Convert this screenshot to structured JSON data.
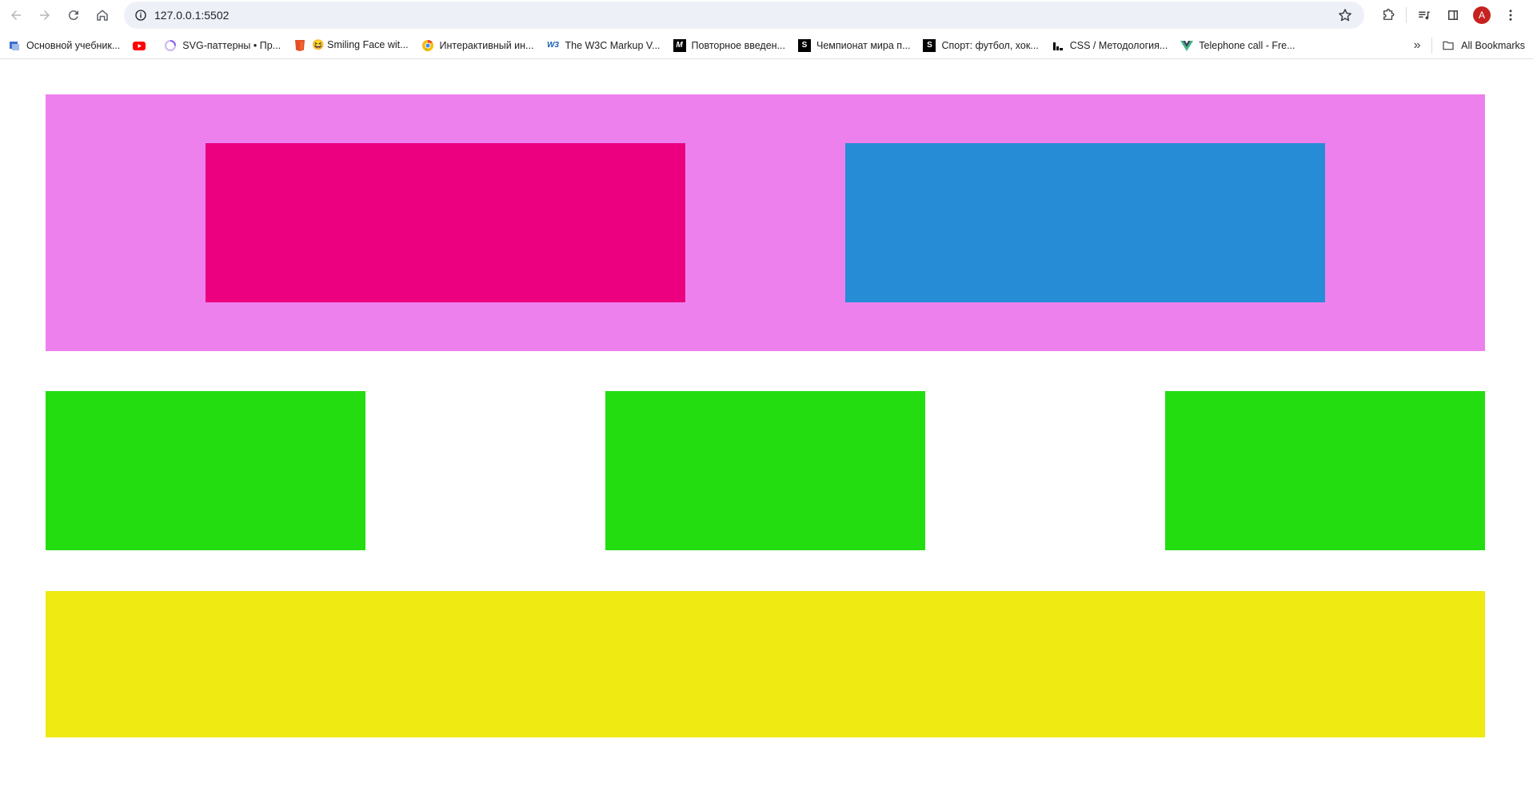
{
  "browser": {
    "url": "127.0.0.1:5502",
    "avatar_letter": "A",
    "all_bookmarks_label": "All Bookmarks",
    "bookmarks": [
      {
        "label": "Основной учебник...",
        "icon": "book-icon"
      },
      {
        "label": "",
        "icon": "youtube-icon"
      },
      {
        "label": "SVG-паттерны • Пр...",
        "icon": "loader-icon"
      },
      {
        "label": "😆 Smiling Face wit...",
        "icon": "html5-icon"
      },
      {
        "label": "Интерактивный ин...",
        "icon": "chrome-icon"
      },
      {
        "label": "The W3C Markup V...",
        "icon": "w3c-icon"
      },
      {
        "label": "Повторное введен...",
        "icon": "m-icon"
      },
      {
        "label": "Чемпионат мира п...",
        "icon": "s-icon"
      },
      {
        "label": "Спорт: футбол, хок...",
        "icon": "s-icon"
      },
      {
        "label": "CSS / Методология...",
        "icon": "chart-icon"
      },
      {
        "label": "Telephone call - Fre...",
        "icon": "vue-icon"
      }
    ]
  },
  "page": {
    "colors": {
      "header_bg": "#ee80ee",
      "pink": "#ec0080",
      "blue": "#258cd5",
      "green": "#23dd10",
      "yellow": "#eeea12"
    }
  }
}
